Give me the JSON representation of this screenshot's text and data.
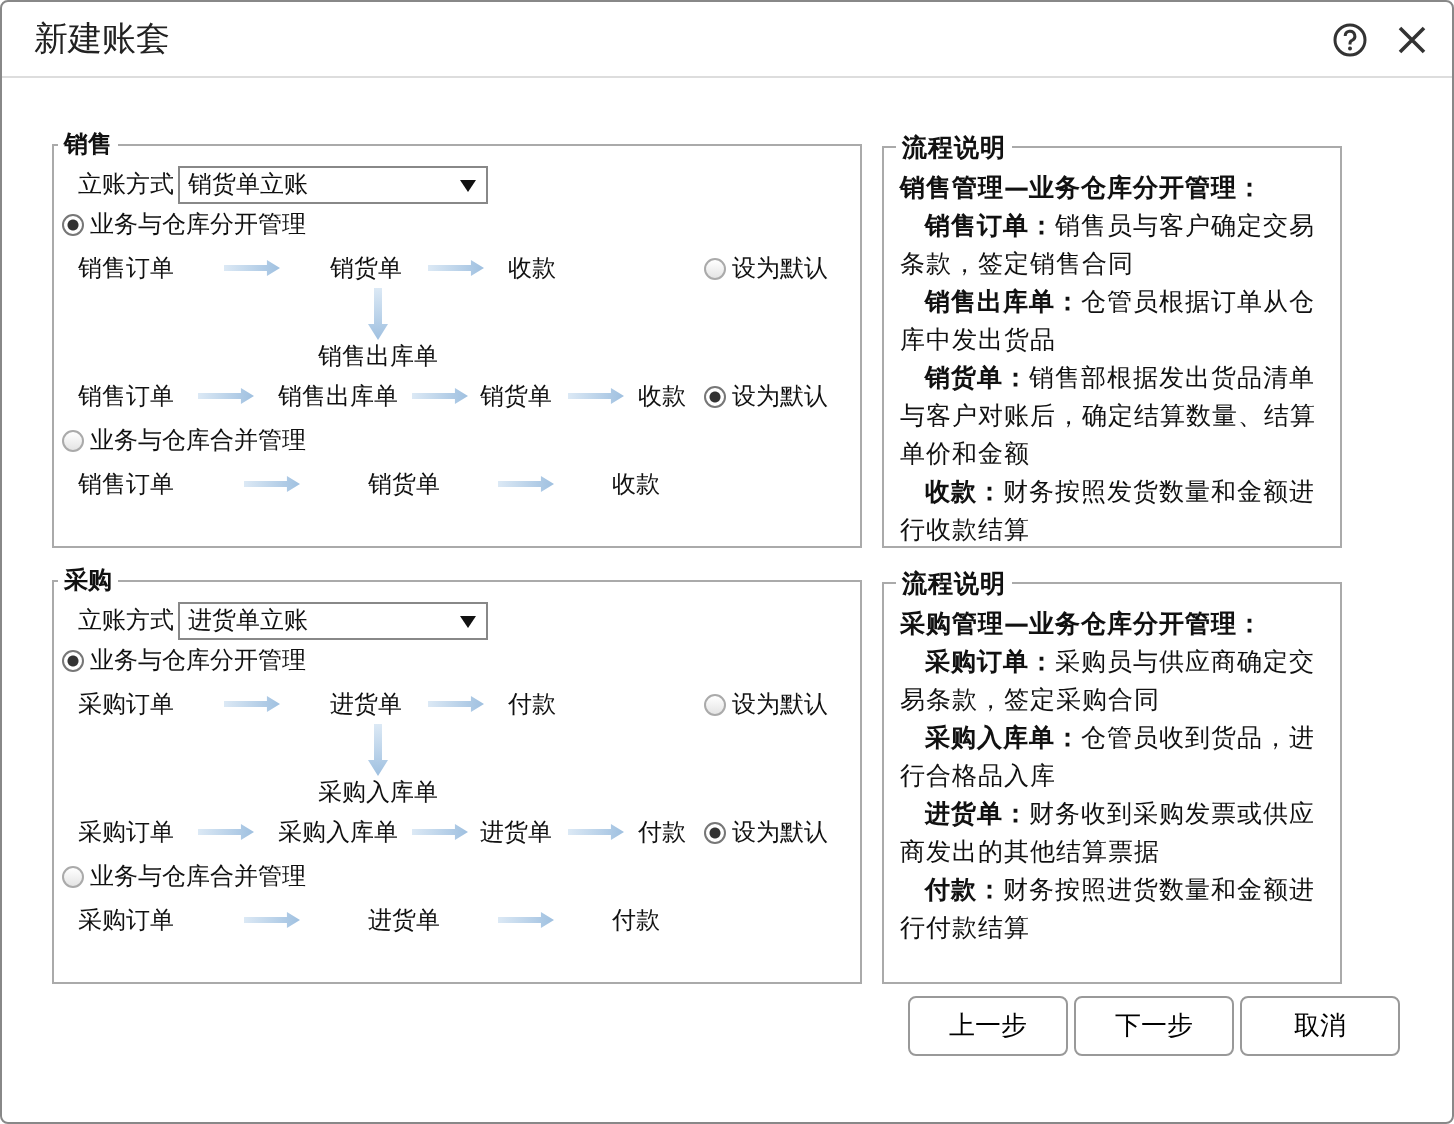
{
  "window": {
    "title": "新建账套"
  },
  "sections": [
    {
      "title": "销售",
      "account_label": "立账方式",
      "account_value": "销货单立账",
      "modes": [
        {
          "label": "业务与仓库分开管理",
          "selected": true,
          "rows": [
            {
              "kind": "flow",
              "steps": [
                "销售订单",
                "销货单",
                "收款"
              ],
              "default": {
                "label": "设为默认",
                "selected": false
              }
            },
            {
              "kind": "branch",
              "label": "销售出库单"
            },
            {
              "kind": "flow",
              "steps": [
                "销售订单",
                "销售出库单",
                "销货单",
                "收款"
              ],
              "default": {
                "label": "设为默认",
                "selected": true
              }
            }
          ]
        },
        {
          "label": "业务与仓库合并管理",
          "selected": false,
          "rows": [
            {
              "kind": "flow",
              "steps": [
                "销售订单",
                "销货单",
                "收款"
              ]
            }
          ]
        }
      ],
      "description": {
        "title": "流程说明",
        "heading": "销售管理—业务仓库分开管理：",
        "entries": [
          "**销售订单：**销售员与客户确定交易条款，签定销售合同",
          "**销售出库单：**仓管员根据订单从仓库中发出货品",
          "**销货单：**销售部根据发出货品清单与客户对账后，确定结算数量、结算单价和金额",
          "**收款：**财务按照发货数量和金额进行收款结算"
        ]
      }
    },
    {
      "title": "采购",
      "account_label": "立账方式",
      "account_value": "进货单立账",
      "modes": [
        {
          "label": "业务与仓库分开管理",
          "selected": true,
          "rows": [
            {
              "kind": "flow",
              "steps": [
                "采购订单",
                "进货单",
                "付款"
              ],
              "default": {
                "label": "设为默认",
                "selected": false
              }
            },
            {
              "kind": "branch",
              "label": "采购入库单"
            },
            {
              "kind": "flow",
              "steps": [
                "采购订单",
                "采购入库单",
                "进货单",
                "付款"
              ],
              "default": {
                "label": "设为默认",
                "selected": true
              }
            }
          ]
        },
        {
          "label": "业务与仓库合并管理",
          "selected": false,
          "rows": [
            {
              "kind": "flow",
              "steps": [
                "采购订单",
                "进货单",
                "付款"
              ]
            }
          ]
        }
      ],
      "description": {
        "title": "流程说明",
        "heading": "采购管理—业务仓库分开管理：",
        "entries": [
          "**采购订单：**采购员与供应商确定交易条款，签定采购合同",
          "**采购入库单：**仓管员收到货品，进行合格品入库",
          "**进货单：**财务收到采购发票或供应商发出的其他结算票据",
          "**付款：**财务按照进货数量和金额进行付款结算"
        ]
      }
    }
  ],
  "buttons": [
    "上一步",
    "下一步",
    "取消"
  ]
}
